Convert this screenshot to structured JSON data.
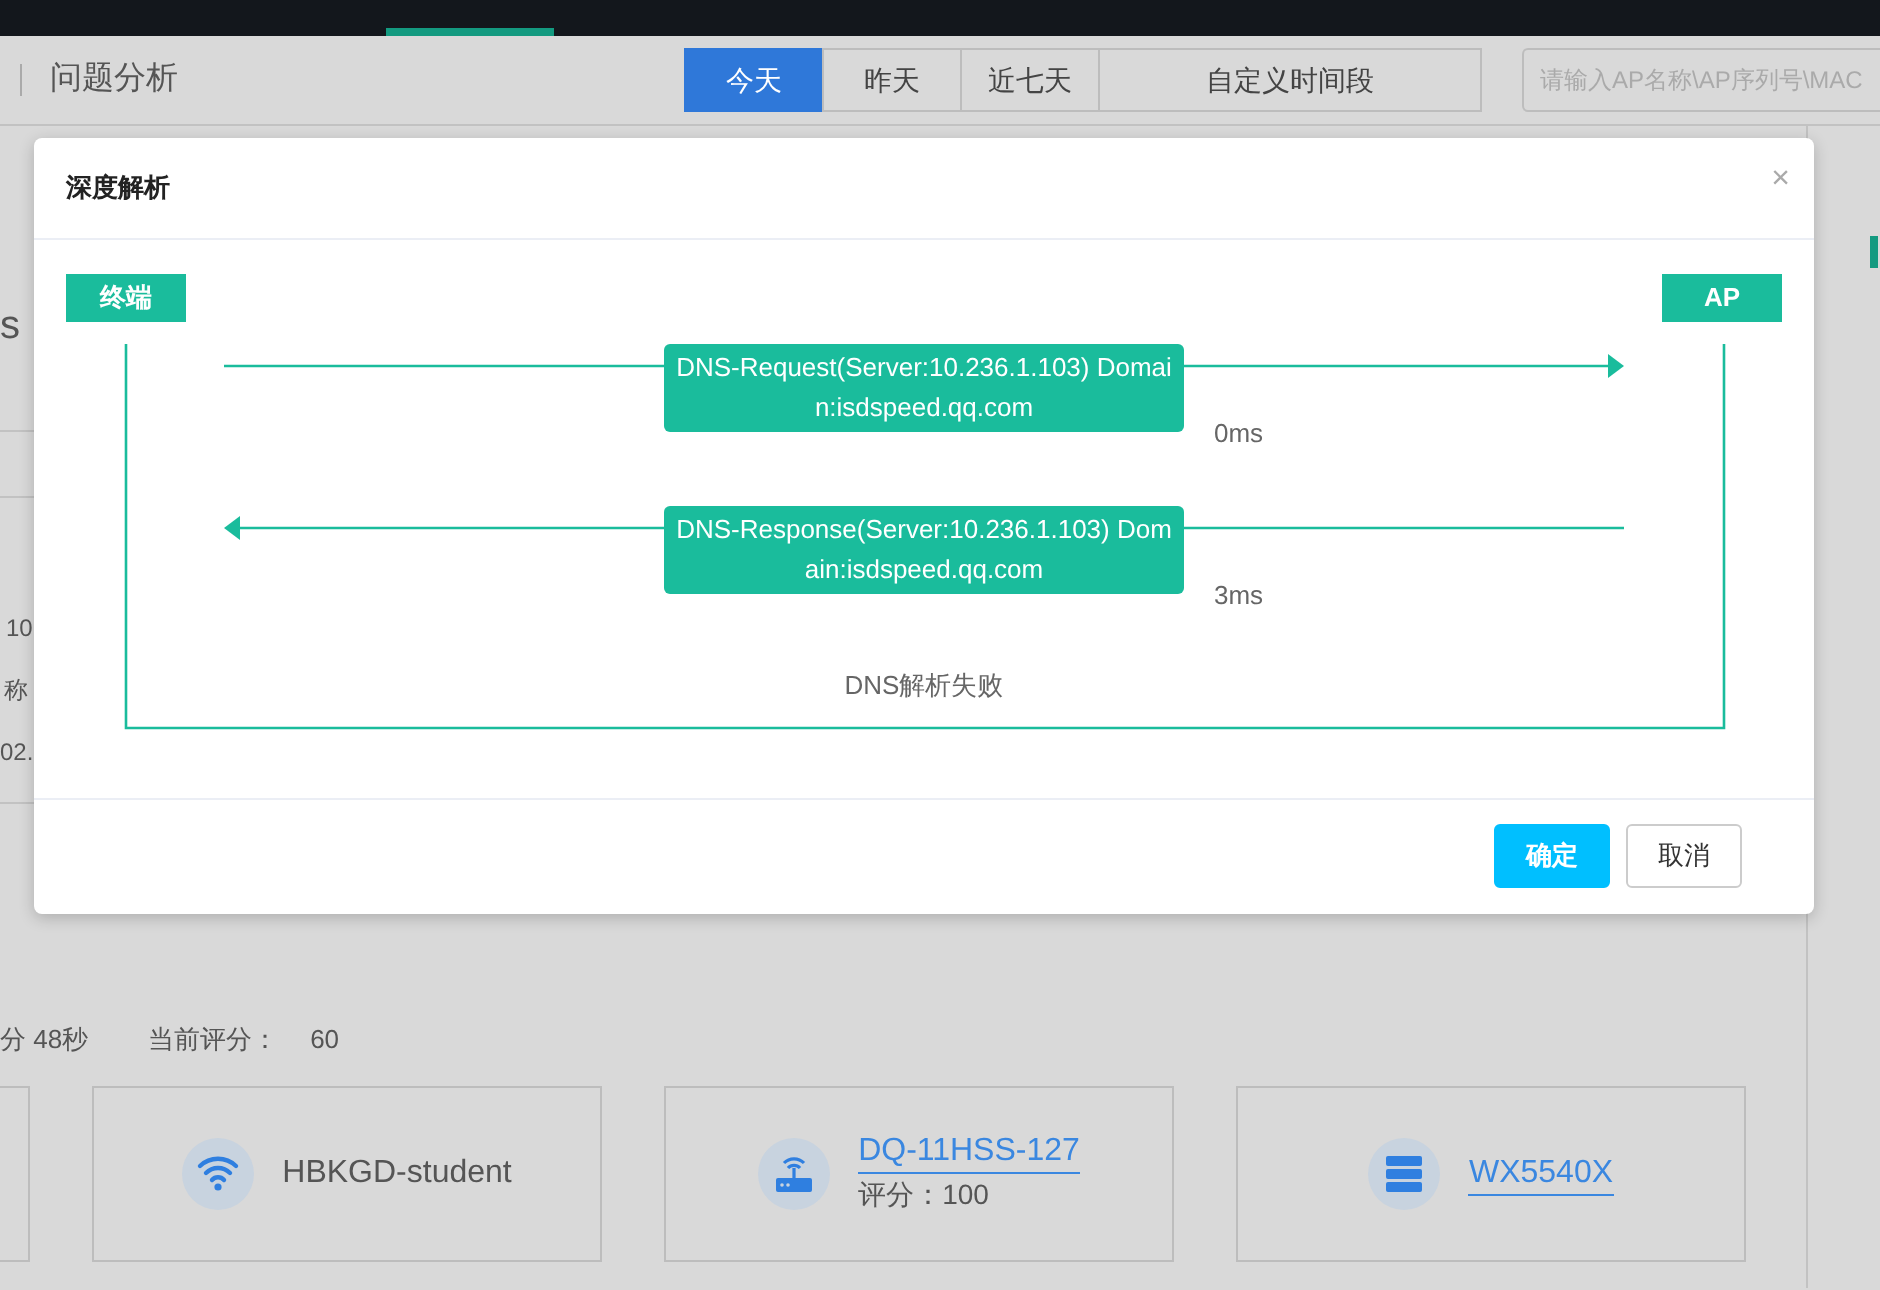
{
  "toolbar": {
    "title": "问题分析",
    "ranges": [
      {
        "label": "今天",
        "selected": true
      },
      {
        "label": "昨天",
        "selected": false
      },
      {
        "label": "近七天",
        "selected": false
      },
      {
        "label": "自定义时间段",
        "selected": false
      }
    ],
    "search": {
      "placeholder": "请输入AP名称\\AP序列号\\MAC"
    }
  },
  "background": {
    "fragments": [
      "s",
      "10",
      "称",
      "02."
    ],
    "duration": "分 48秒",
    "score_label": "当前评分：",
    "score": "60",
    "cards": [
      {
        "kind": "partial"
      },
      {
        "kind": "ssid",
        "name": "HBKGD-student"
      },
      {
        "kind": "ap",
        "name": "DQ-11HSS-127",
        "score": "评分：100"
      },
      {
        "kind": "controller",
        "name": "WX5540X"
      }
    ]
  },
  "dialog": {
    "title": "深度解析",
    "close": "×",
    "endpoints": [
      "终端",
      "AP"
    ],
    "messages": [
      {
        "kind": "request",
        "text": "DNS-Request(Server:10.236.1.103) Domain:isdspeed.qq.com",
        "latency": "0ms"
      },
      {
        "kind": "response",
        "text": "DNS-Response(Server:10.236.1.103) Domain:isdspeed.qq.com",
        "latency": "3ms"
      }
    ],
    "result": "DNS解析失败",
    "buttons": [
      {
        "kind": "primary",
        "label": "确定"
      },
      {
        "kind": "default",
        "label": "取消"
      }
    ]
  }
}
